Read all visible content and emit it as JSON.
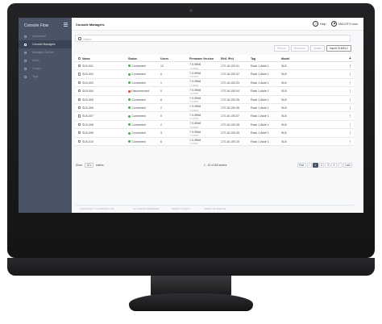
{
  "sidebar": {
    "brand": "Console Flow",
    "items": [
      {
        "label": "Dashboard",
        "active": false
      },
      {
        "label": "Console Managers",
        "active": true
      },
      {
        "label": "Managed Devices",
        "active": false
      },
      {
        "label": "Users",
        "active": false
      },
      {
        "label": "Groups",
        "active": false
      },
      {
        "label": "Tags",
        "active": false
      }
    ]
  },
  "header": {
    "title": "Console Managers",
    "help_label": "Help",
    "user_label": "MACHTO User"
  },
  "search": {
    "placeholder": "Search"
  },
  "toolbar": {
    "buttons": [
      {
        "label": "Reboot",
        "enabled": false
      },
      {
        "label": "Shutdown",
        "enabled": false
      },
      {
        "label": "Update",
        "enabled": false
      },
      {
        "label": "Import SLB/SLC",
        "enabled": true
      }
    ]
  },
  "table": {
    "columns": [
      "Name",
      "Status",
      "Users",
      "Firmware Version",
      "Eth1 IPv4",
      "Tag",
      "Model"
    ],
    "add_symbol": "+",
    "more_symbol": "⋮",
    "rows": [
      {
        "name": "SLB-001",
        "status": "Connected",
        "users": "12",
        "fw": "7.0.0f5r8",
        "fw_sub": "7.0.0f5r8",
        "ip": "172.16.100.01",
        "tag": "Rack 1 Aisle 1",
        "model": "SLB"
      },
      {
        "name": "SLB-002",
        "status": "Connected",
        "users": "0",
        "fw": "7.0.0f5r8",
        "fw_sub": "7.0.0f5r8",
        "ip": "172.16.100.02",
        "tag": "Rack 1 Aisle 1",
        "model": "SLB"
      },
      {
        "name": "SLB-003",
        "status": "Connected",
        "users": "1",
        "fw": "7.0.0f5r8",
        "fw_sub": "7.0.0f5r8",
        "ip": "172.16.100.03",
        "tag": "Rack 1 Aisle 1",
        "model": "SLB"
      },
      {
        "name": "SLB-004",
        "status": "Disconnected",
        "users": "0",
        "fw": "7.0.0f5r8",
        "fw_sub": "7.0.0f5r8",
        "ip": "172.16.100.04",
        "tag": "Rack 1 Aisle 1",
        "model": "SLB"
      },
      {
        "name": "SLB-005",
        "status": "Connected",
        "users": "8",
        "fw": "7.0.0f5r8",
        "fw_sub": "7.0.0f5r8",
        "ip": "172.16.100.05",
        "tag": "Rack 1 Aisle 1",
        "model": "SLB"
      },
      {
        "name": "SLB-006",
        "status": "Connected",
        "users": "2",
        "fw": "7.0.0f5r8",
        "fw_sub": "7.0.0f5r8",
        "ip": "172.16.100.06",
        "tag": "Rack 1 Aisle 1",
        "model": "SLB"
      },
      {
        "name": "SLB-007",
        "status": "Connected",
        "users": "0",
        "fw": "7.0.0f5r8",
        "fw_sub": "7.0.0f5r8",
        "ip": "172.16.100.07",
        "tag": "Rack 1 Aisle 1",
        "model": "SLB"
      },
      {
        "name": "SLB-008",
        "status": "Connected",
        "users": "2",
        "fw": "7.0.0f5r8",
        "fw_sub": "7.0.0f5r8",
        "ip": "172.16.100.08",
        "tag": "Rack 1 Aisle 1",
        "model": "SLB"
      },
      {
        "name": "SLB-009",
        "status": "Connected",
        "users": "3",
        "fw": "7.0.0f5r8",
        "fw_sub": "7.0.0f5r8",
        "ip": "172.16.100.09",
        "tag": "Rack 1 Aisle 1",
        "model": "SLB"
      },
      {
        "name": "SLB-010",
        "status": "Connected",
        "users": "6",
        "fw": "7.0.0f5r8",
        "fw_sub": "7.0.0f5r8",
        "ip": "172.16.100.10",
        "tag": "Rack 1 Aisle 1",
        "model": "SLB"
      }
    ]
  },
  "status_colors": {
    "Connected": "#3cb44b",
    "Disconnected": "#e04a3a"
  },
  "pagination": {
    "show_label": "Show",
    "page_size": "10",
    "entries_label": "entries",
    "range_text": "1 - 10 of 200 entries",
    "pages": [
      "First",
      "‹",
      "1",
      "2",
      "3",
      "4",
      "›",
      "Last"
    ],
    "current": "1"
  },
  "footer": {
    "copyright": "COPYRIGHT © LANTRONIX, INC.",
    "rights": "ALL RIGHTS RESERVED",
    "privacy": "PRIVACY POLICY",
    "terms": "TERMS OF SERVICE"
  }
}
